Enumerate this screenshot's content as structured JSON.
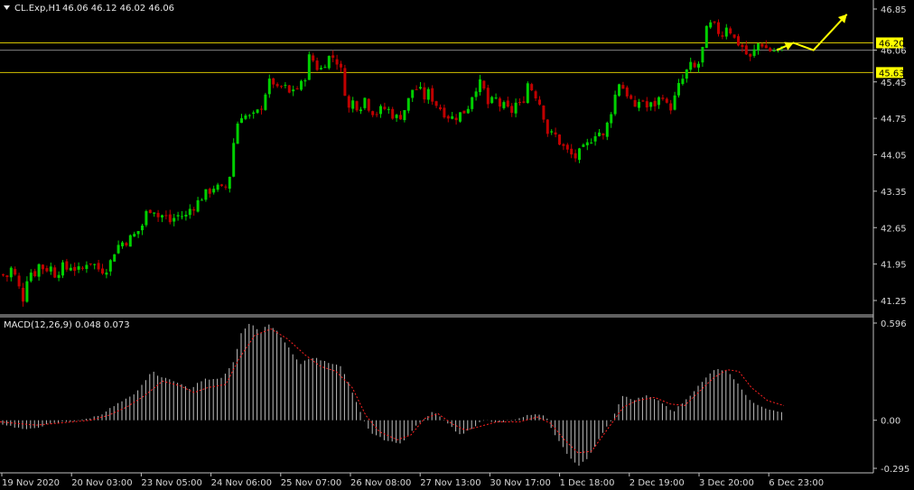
{
  "window": {
    "symbol_label": "CL.Exp,H1",
    "ohlc_text": "46.06 46.12 46.02 46.06",
    "menu_glyph": "triangle-down-icon"
  },
  "colors": {
    "background": "#000000",
    "bull": "#00d000",
    "bear": "#c00000",
    "level_line": "#d4c300",
    "current_price_line": "#808080",
    "arrow": "#ffff00",
    "macd_hist": "#c0c0c0",
    "macd_signal": "#ff2020",
    "axis": "#c0c0c0",
    "price_tag_bg": "#ffff00"
  },
  "chart_data": [
    {
      "type": "candlestick",
      "title": "CL.Exp,H1",
      "ylim": [
        41.0,
        47.0
      ],
      "y_ticks": [
        "46.85",
        "46.06",
        "45.45",
        "44.75",
        "44.05",
        "43.35",
        "42.65",
        "41.95",
        "41.25"
      ],
      "x_ticks": [
        "19 Nov 2020",
        "20 Nov 03:00",
        "23 Nov 05:00",
        "24 Nov 06:00",
        "25 Nov 07:00",
        "26 Nov 08:00",
        "27 Nov 13:00",
        "30 Nov 17:00",
        "1 Dec 18:00",
        "2 Dec 19:00",
        "3 Dec 20:00",
        "6 Dec 23:00"
      ],
      "current_price": 46.06,
      "levels": [
        {
          "label": "46.20",
          "value": 46.2
        },
        {
          "label": "45.63",
          "value": 45.63
        }
      ],
      "projection_path": [
        [
          0,
          46.06
        ],
        [
          10,
          46.2
        ],
        [
          22,
          46.06
        ],
        [
          42,
          46.75
        ]
      ],
      "close_path": [
        [
          0,
          41.75
        ],
        [
          6,
          41.7
        ],
        [
          12,
          41.9
        ],
        [
          18,
          41.55
        ],
        [
          24,
          41.3
        ],
        [
          30,
          41.85
        ],
        [
          36,
          41.75
        ],
        [
          42,
          41.95
        ],
        [
          48,
          41.85
        ],
        [
          54,
          41.9
        ],
        [
          60,
          41.75
        ],
        [
          66,
          41.9
        ],
        [
          72,
          41.85
        ],
        [
          78,
          41.95
        ],
        [
          84,
          41.8
        ],
        [
          90,
          41.85
        ],
        [
          96,
          42.05
        ],
        [
          102,
          41.95
        ],
        [
          108,
          41.85
        ],
        [
          114,
          41.85
        ],
        [
          120,
          41.95
        ],
        [
          126,
          42.25
        ],
        [
          132,
          42.35
        ],
        [
          138,
          42.4
        ],
        [
          144,
          42.45
        ],
        [
          150,
          42.55
        ],
        [
          156,
          42.7
        ],
        [
          162,
          43.0
        ],
        [
          168,
          43.05
        ],
        [
          174,
          42.85
        ],
        [
          180,
          42.9
        ],
        [
          186,
          42.75
        ],
        [
          192,
          42.85
        ],
        [
          198,
          42.9
        ],
        [
          204,
          42.85
        ],
        [
          210,
          43.05
        ],
        [
          216,
          43.1
        ],
        [
          222,
          43.25
        ],
        [
          228,
          43.3
        ],
        [
          234,
          43.45
        ],
        [
          240,
          43.4
        ],
        [
          246,
          43.35
        ],
        [
          252,
          43.55
        ],
        [
          258,
          44.4
        ],
        [
          264,
          44.85
        ],
        [
          270,
          44.8
        ],
        [
          276,
          44.75
        ],
        [
          282,
          44.8
        ],
        [
          288,
          45.0
        ],
        [
          294,
          45.35
        ],
        [
          300,
          45.5
        ],
        [
          306,
          45.25
        ],
        [
          312,
          45.4
        ],
        [
          318,
          45.2
        ],
        [
          324,
          45.35
        ],
        [
          330,
          45.3
        ],
        [
          336,
          45.55
        ],
        [
          342,
          46.0
        ],
        [
          348,
          45.75
        ],
        [
          354,
          45.7
        ],
        [
          360,
          45.9
        ],
        [
          366,
          45.95
        ],
        [
          372,
          45.85
        ],
        [
          378,
          45.55
        ],
        [
          384,
          44.9
        ],
        [
          390,
          45.1
        ],
        [
          396,
          44.95
        ],
        [
          402,
          45.15
        ],
        [
          408,
          44.95
        ],
        [
          414,
          44.85
        ],
        [
          420,
          44.9
        ],
        [
          426,
          44.95
        ],
        [
          432,
          44.85
        ],
        [
          438,
          44.75
        ],
        [
          444,
          44.85
        ],
        [
          450,
          45.05
        ],
        [
          456,
          45.35
        ],
        [
          462,
          45.3
        ],
        [
          468,
          45.15
        ],
        [
          474,
          45.25
        ],
        [
          480,
          45.05
        ],
        [
          486,
          44.95
        ],
        [
          492,
          44.85
        ],
        [
          498,
          44.75
        ],
        [
          504,
          44.8
        ],
        [
          510,
          44.85
        ],
        [
          516,
          44.95
        ],
        [
          522,
          45.25
        ],
        [
          528,
          45.45
        ],
        [
          534,
          45.3
        ],
        [
          540,
          44.95
        ],
        [
          546,
          45.15
        ],
        [
          552,
          45.0
        ],
        [
          558,
          44.95
        ],
        [
          564,
          44.85
        ],
        [
          570,
          45.05
        ],
        [
          576,
          44.95
        ],
        [
          582,
          45.45
        ],
        [
          588,
          45.3
        ],
        [
          594,
          45.15
        ],
        [
          600,
          44.85
        ],
        [
          606,
          44.4
        ],
        [
          612,
          44.45
        ],
        [
          618,
          44.3
        ],
        [
          624,
          44.15
        ],
        [
          630,
          44.05
        ],
        [
          636,
          44.0
        ],
        [
          642,
          44.1
        ],
        [
          648,
          44.2
        ],
        [
          654,
          44.4
        ],
        [
          660,
          44.55
        ],
        [
          666,
          44.35
        ],
        [
          672,
          44.7
        ],
        [
          678,
          45.1
        ],
        [
          684,
          45.45
        ],
        [
          690,
          45.3
        ],
        [
          696,
          45.15
        ],
        [
          702,
          44.85
        ],
        [
          708,
          45.2
        ],
        [
          714,
          44.95
        ],
        [
          720,
          45.0
        ],
        [
          726,
          45.05
        ],
        [
          732,
          45.25
        ],
        [
          738,
          44.9
        ],
        [
          744,
          45.05
        ],
        [
          750,
          45.35
        ],
        [
          756,
          45.55
        ],
        [
          762,
          45.75
        ],
        [
          768,
          45.7
        ],
        [
          774,
          45.85
        ],
        [
          780,
          46.4
        ],
        [
          786,
          46.55
        ],
        [
          792,
          46.45
        ],
        [
          798,
          46.35
        ],
        [
          804,
          46.6
        ],
        [
          810,
          46.3
        ],
        [
          816,
          46.2
        ],
        [
          822,
          46.1
        ],
        [
          828,
          45.85
        ],
        [
          834,
          46.05
        ],
        [
          840,
          46.25
        ],
        [
          846,
          46.1
        ],
        [
          852,
          46.05
        ],
        [
          858,
          46.06
        ]
      ]
    },
    {
      "type": "bar",
      "title": "MACD(12,26,9) 0.048 0.073",
      "ylim": [
        -0.33,
        0.62
      ],
      "y_ticks": [
        "0.596",
        "0.00",
        "-0.295"
      ],
      "series": [
        {
          "name": "MACD",
          "path": [
            [
              0,
              -0.02
            ],
            [
              15,
              -0.04
            ],
            [
              30,
              -0.06
            ],
            [
              50,
              -0.03
            ],
            [
              70,
              -0.01
            ],
            [
              90,
              0.0
            ],
            [
              110,
              0.03
            ],
            [
              130,
              0.1
            ],
            [
              150,
              0.16
            ],
            [
              168,
              0.3
            ],
            [
              180,
              0.26
            ],
            [
              195,
              0.24
            ],
            [
              210,
              0.19
            ],
            [
              225,
              0.25
            ],
            [
              245,
              0.26
            ],
            [
              258,
              0.35
            ],
            [
              268,
              0.55
            ],
            [
              278,
              0.6
            ],
            [
              288,
              0.53
            ],
            [
              296,
              0.59
            ],
            [
              306,
              0.55
            ],
            [
              320,
              0.44
            ],
            [
              332,
              0.34
            ],
            [
              344,
              0.39
            ],
            [
              360,
              0.36
            ],
            [
              376,
              0.34
            ],
            [
              386,
              0.23
            ],
            [
              398,
              0.06
            ],
            [
              410,
              -0.08
            ],
            [
              430,
              -0.13
            ],
            [
              445,
              -0.14
            ],
            [
              460,
              -0.04
            ],
            [
              480,
              0.06
            ],
            [
              495,
              -0.02
            ],
            [
              510,
              -0.09
            ],
            [
              522,
              -0.05
            ],
            [
              535,
              0.0
            ],
            [
              550,
              -0.01
            ],
            [
              570,
              0.0
            ],
            [
              590,
              0.04
            ],
            [
              605,
              0.02
            ],
            [
              615,
              -0.1
            ],
            [
              630,
              -0.22
            ],
            [
              640,
              -0.28
            ],
            [
              650,
              -0.24
            ],
            [
              665,
              -0.1
            ],
            [
              680,
              0.03
            ],
            [
              690,
              0.16
            ],
            [
              700,
              0.12
            ],
            [
              715,
              0.15
            ],
            [
              730,
              0.12
            ],
            [
              745,
              0.05
            ],
            [
              760,
              0.13
            ],
            [
              775,
              0.22
            ],
            [
              792,
              0.32
            ],
            [
              806,
              0.3
            ],
            [
              818,
              0.22
            ],
            [
              830,
              0.12
            ],
            [
              850,
              0.07
            ],
            [
              868,
              0.05
            ]
          ]
        },
        {
          "name": "Signal",
          "path": [
            [
              0,
              -0.01
            ],
            [
              20,
              -0.02
            ],
            [
              40,
              -0.03
            ],
            [
              60,
              -0.02
            ],
            [
              80,
              -0.01
            ],
            [
              100,
              0.0
            ],
            [
              120,
              0.03
            ],
            [
              140,
              0.08
            ],
            [
              160,
              0.15
            ],
            [
              180,
              0.24
            ],
            [
              200,
              0.21
            ],
            [
              215,
              0.17
            ],
            [
              230,
              0.2
            ],
            [
              250,
              0.22
            ],
            [
              265,
              0.38
            ],
            [
              282,
              0.52
            ],
            [
              300,
              0.56
            ],
            [
              318,
              0.5
            ],
            [
              338,
              0.4
            ],
            [
              355,
              0.33
            ],
            [
              372,
              0.3
            ],
            [
              390,
              0.2
            ],
            [
              405,
              0.03
            ],
            [
              420,
              -0.07
            ],
            [
              440,
              -0.12
            ],
            [
              455,
              -0.09
            ],
            [
              470,
              0.01
            ],
            [
              485,
              0.04
            ],
            [
              500,
              -0.02
            ],
            [
              515,
              -0.06
            ],
            [
              530,
              -0.04
            ],
            [
              550,
              -0.01
            ],
            [
              575,
              -0.01
            ],
            [
              595,
              0.02
            ],
            [
              610,
              -0.02
            ],
            [
              625,
              -0.12
            ],
            [
              640,
              -0.2
            ],
            [
              655,
              -0.19
            ],
            [
              672,
              -0.06
            ],
            [
              690,
              0.08
            ],
            [
              705,
              0.12
            ],
            [
              725,
              0.14
            ],
            [
              742,
              0.1
            ],
            [
              758,
              0.09
            ],
            [
              775,
              0.18
            ],
            [
              790,
              0.26
            ],
            [
              805,
              0.31
            ],
            [
              818,
              0.3
            ],
            [
              832,
              0.2
            ],
            [
              850,
              0.12
            ],
            [
              868,
              0.09
            ]
          ]
        }
      ]
    }
  ]
}
